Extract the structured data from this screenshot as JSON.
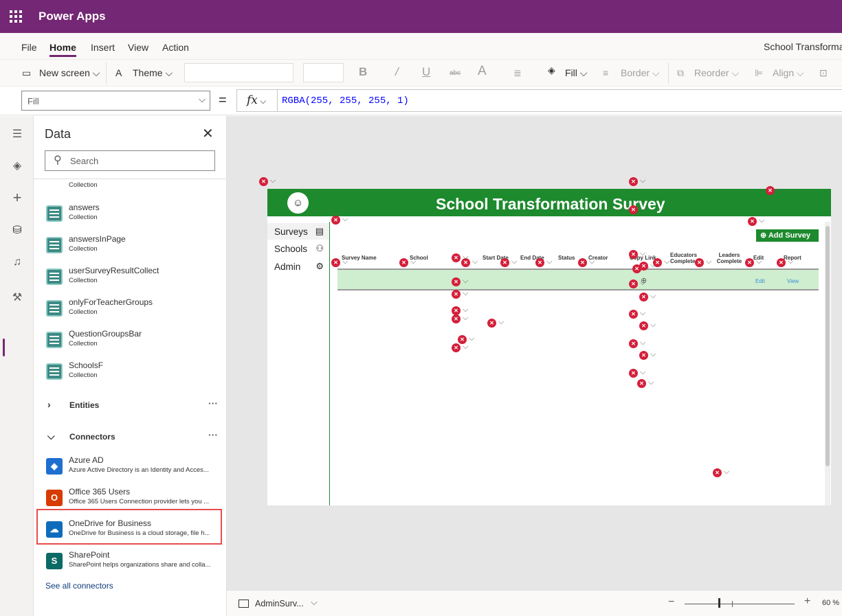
{
  "app": {
    "title": "Power Apps",
    "name": "School Transforma"
  },
  "menu": [
    "File",
    "Home",
    "Insert",
    "View",
    "Action"
  ],
  "toolbar": {
    "new_screen": "New screen",
    "theme": "Theme",
    "fill": "Fill",
    "border": "Border",
    "reorder": "Reorder",
    "align": "Align"
  },
  "formula": {
    "property": "Fill",
    "equals": "=",
    "fx": "fx",
    "value": "RGBA(255, 255, 255, 1)"
  },
  "data_panel": {
    "title": "Data",
    "search_placeholder": "Search",
    "partial_item_sub": "Collection",
    "collections": [
      {
        "name": "answers",
        "sub": "Collection"
      },
      {
        "name": "answersInPage",
        "sub": "Collection"
      },
      {
        "name": "userSurveyResultCollect",
        "sub": "Collection"
      },
      {
        "name": "onlyForTeacherGroups",
        "sub": "Collection"
      },
      {
        "name": "QuestionGroupsBar",
        "sub": "Collection"
      },
      {
        "name": "SchoolsF",
        "sub": "Collection"
      }
    ],
    "entities_label": "Entities",
    "connectors_label": "Connectors",
    "more": "···",
    "connectors": [
      {
        "name": "Azure AD",
        "desc": "Azure Active Directory is an Identity and Acces...",
        "color": "#1f6fd1"
      },
      {
        "name": "Office 365 Users",
        "desc": "Office 365 Users Connection provider lets you ...",
        "color": "#d83b01"
      },
      {
        "name": "OneDrive for Business",
        "desc": "OneDrive for Business is a cloud storage, file h...",
        "color": "#0f6cbd"
      },
      {
        "name": "SharePoint",
        "desc": "SharePoint helps organizations share and colla...",
        "color": "#0b6a66"
      }
    ],
    "see_all": "See all connectors"
  },
  "canvas": {
    "title": "School Transformation Survey",
    "nav": [
      {
        "label": "Surveys",
        "icon": "▤"
      },
      {
        "label": "Schools",
        "icon": "⚇"
      },
      {
        "label": "Admin",
        "icon": "⚙"
      }
    ],
    "add_button": "⊕ Add Survey",
    "columns": [
      {
        "label": "Survey Name"
      },
      {
        "label": "School"
      },
      {
        "label": "Start Date"
      },
      {
        "label": "End Date"
      },
      {
        "label": "Status"
      },
      {
        "label": "Creator"
      },
      {
        "label": "Copy Link"
      },
      {
        "label": "Educators Complete"
      },
      {
        "label": "Leaders Complete"
      },
      {
        "label": "Edit"
      },
      {
        "label": "Report"
      }
    ],
    "row_links": {
      "edit": "Edit",
      "view": "View"
    }
  },
  "status": {
    "screen": "AdminSurv...",
    "zoom": "60 %"
  },
  "colors": {
    "brand": "#742774",
    "header_green": "#1d8a2d",
    "error_red": "#d41f3a"
  }
}
